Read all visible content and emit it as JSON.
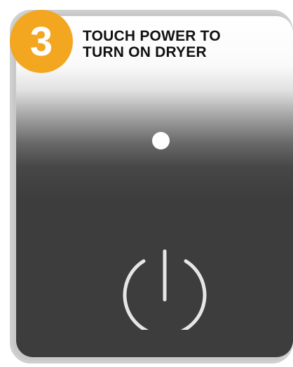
{
  "step": {
    "number": "3",
    "badge_color": "#f3a620"
  },
  "instruction": {
    "text": "TOUCH POWER TO\nTURN ON DRYER"
  },
  "indicator": {
    "state": "on",
    "color": "#ffffff"
  },
  "power_button": {
    "icon": "power-icon",
    "color": "#e6e6e6"
  },
  "panel": {
    "face_color": "#3d3d3d",
    "frame_color": "#c9c9c9"
  }
}
